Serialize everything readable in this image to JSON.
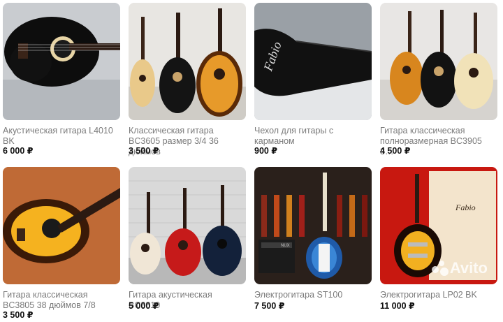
{
  "listings": [
    {
      "title": "Акустическая гитара L4010 BK",
      "price": "6 000 ₽"
    },
    {
      "title": "Классическая гитара BC3605 размер 3/4 36 дюймов",
      "price": "3 500 ₽"
    },
    {
      "title": "Чехол для гитары с карманом",
      "price": "900 ₽"
    },
    {
      "title": "Гитара классическая полноразмерная BC3905 3…",
      "price": "4 500 ₽"
    },
    {
      "title": "Гитара классическая BC3805 38 дюймов 7/8",
      "price": "3 500 ₽"
    },
    {
      "title": "Гитара акустическая BC3810",
      "price": "5 000 ₽"
    },
    {
      "title": "Электрогитара ST100",
      "price": "7 500 ₽"
    },
    {
      "title": "Электрогитара LP02 BK",
      "price": "11 000 ₽"
    }
  ],
  "case_brand": "Fabio",
  "box_brand": "Fabio",
  "amp_brand": "NUX",
  "watermark_text": "Avito",
  "colors": {
    "price": "#111111",
    "title": "#7a7a7a",
    "background": "#ffffff"
  }
}
